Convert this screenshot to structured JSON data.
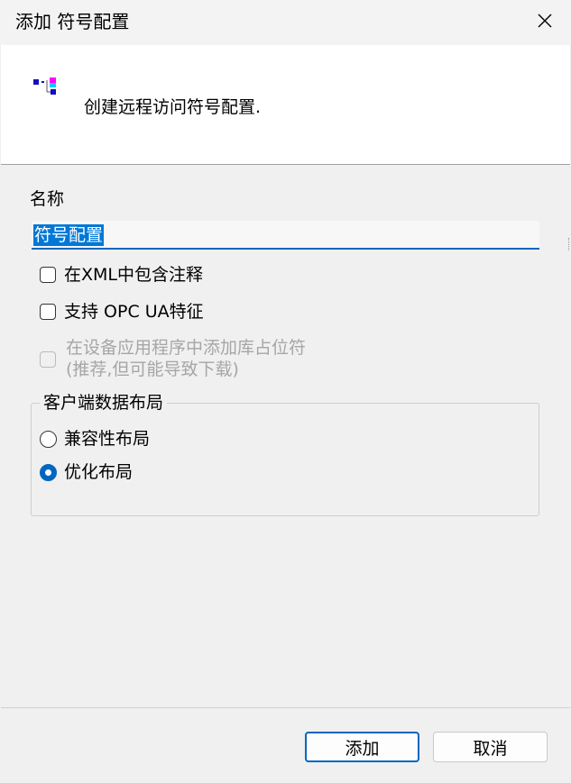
{
  "window": {
    "title": "添加 符号配置"
  },
  "header": {
    "icon": "symbol-config-icon",
    "description": "创建远程访问符号配置."
  },
  "name_field": {
    "label": "名称",
    "value": "符号配置"
  },
  "options": {
    "include_comments_xml": {
      "label": "在XML中包含注释",
      "checked": false
    },
    "support_opc_ua": {
      "label": "支持 OPC UA特征",
      "checked": false
    },
    "add_library_placeholder": {
      "label_line1": "在设备应用程序中添加库占位符",
      "label_line2": "(推荐,但可能导致下载)",
      "checked": false,
      "enabled": false
    }
  },
  "client_layout": {
    "legend": "客户端数据布局",
    "options": [
      {
        "label": "兼容性布局",
        "selected": false
      },
      {
        "label": "优化布局",
        "selected": true
      }
    ]
  },
  "buttons": {
    "add": "添加",
    "cancel": "取消"
  },
  "colors": {
    "accent": "#0067c0",
    "selection": "#0078d7",
    "window_bg": "#f0f0f0",
    "header_bg": "#ffffff"
  }
}
